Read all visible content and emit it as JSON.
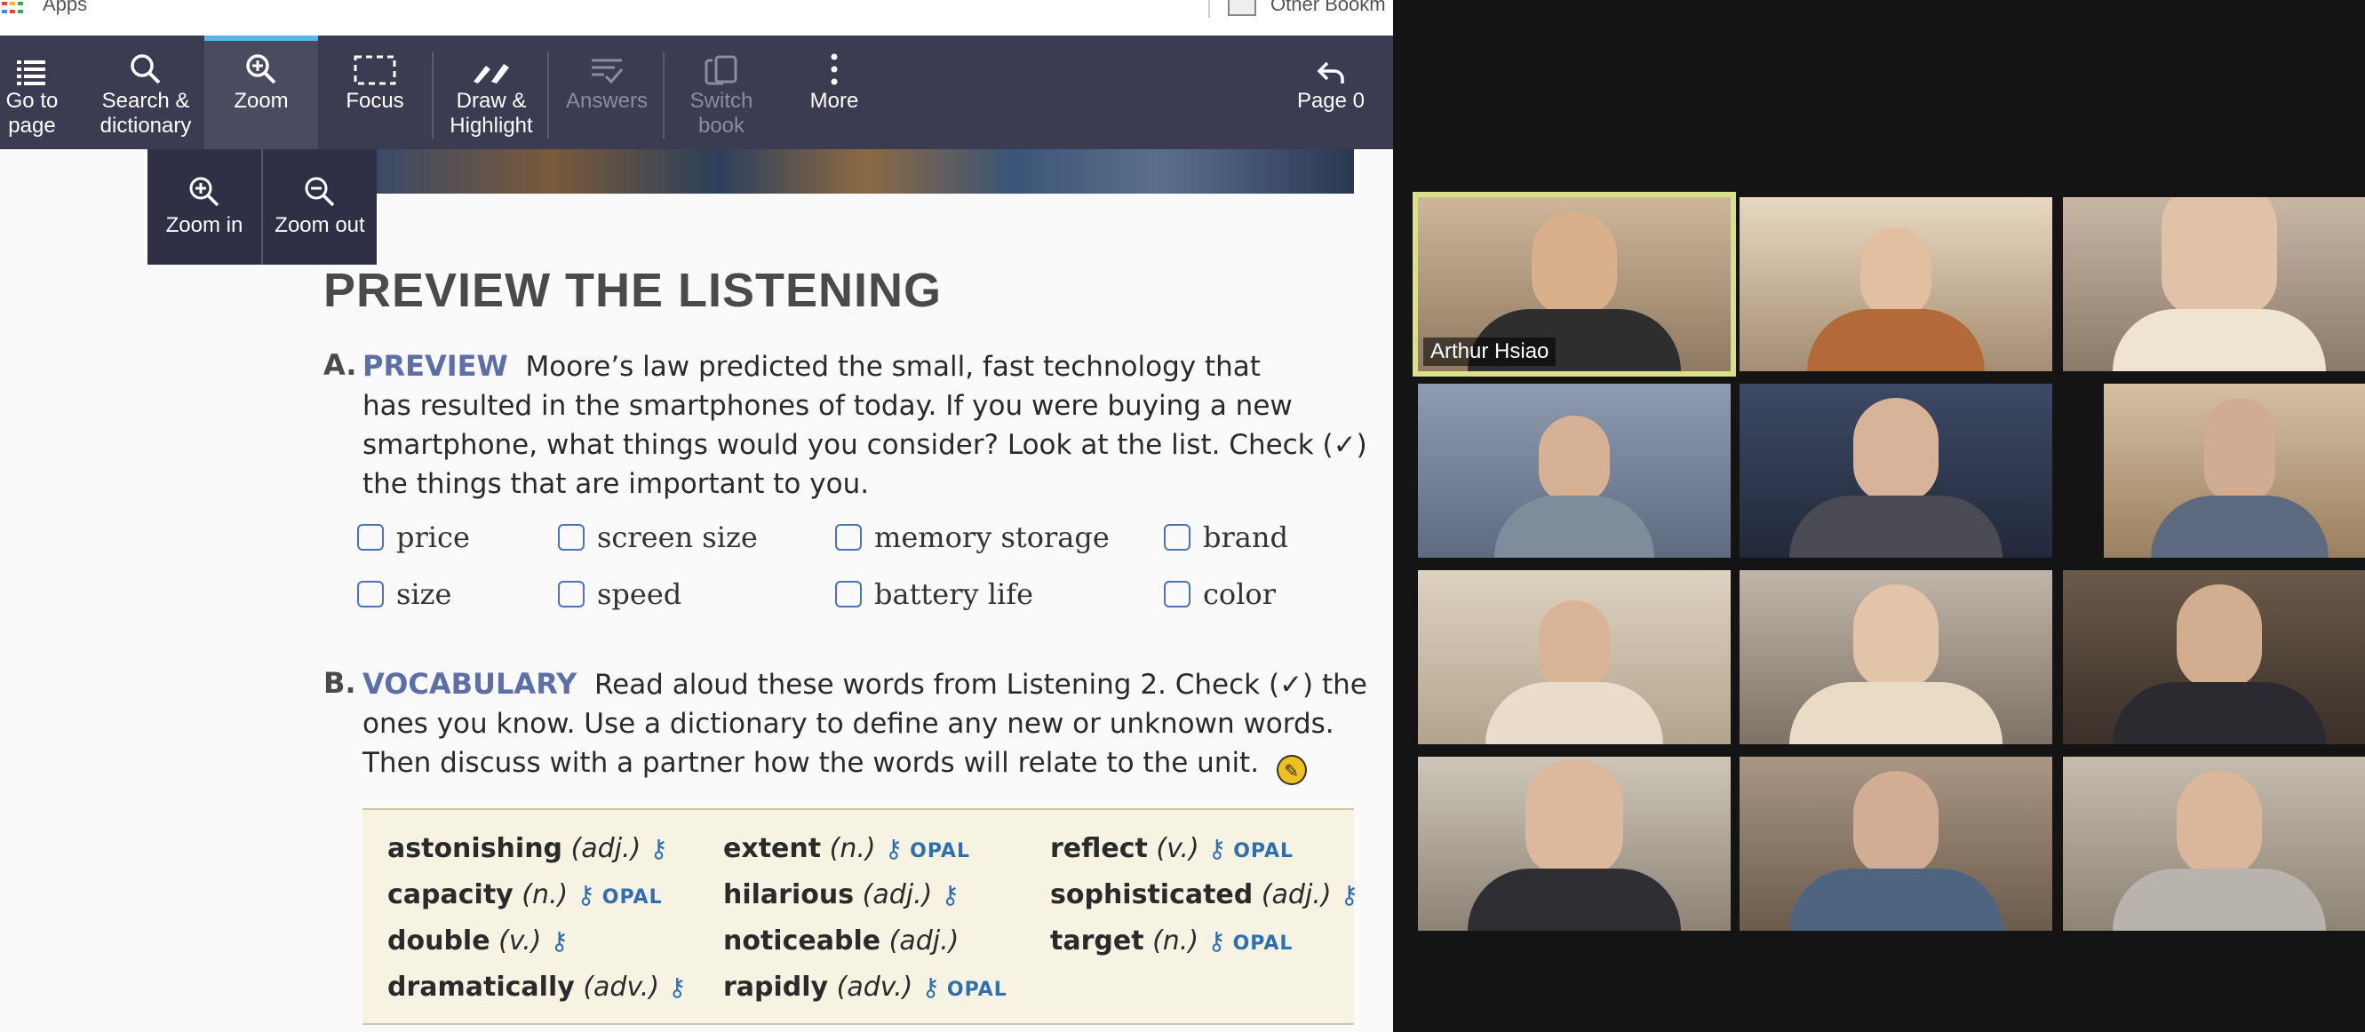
{
  "browser": {
    "apps_label": "Apps",
    "other_bookmarks_label": "Other Bookm"
  },
  "toolbar": {
    "items": [
      {
        "label_line1": "Go to",
        "label_line2": "page",
        "icon": "list-icon",
        "state": "normal"
      },
      {
        "label_line1": "Search &",
        "label_line2": "dictionary",
        "icon": "search-icon",
        "state": "normal"
      },
      {
        "label_line1": "Zoom",
        "label_line2": "",
        "icon": "zoom-icon",
        "state": "active"
      },
      {
        "label_line1": "Focus",
        "label_line2": "",
        "icon": "focus-icon",
        "state": "normal"
      },
      {
        "label_line1": "Draw &",
        "label_line2": "Highlight",
        "icon": "pen-icon",
        "state": "normal"
      },
      {
        "label_line1": "Answers",
        "label_line2": "",
        "icon": "answers-icon",
        "state": "disabled"
      },
      {
        "label_line1": "Switch",
        "label_line2": "book",
        "icon": "switch-book-icon",
        "state": "disabled"
      },
      {
        "label_line1": "More",
        "label_line2": "",
        "icon": "more-icon",
        "state": "normal"
      }
    ],
    "page_label": "Page 0",
    "active_color": "#58b7e8"
  },
  "zoom_menu": {
    "zoom_in": "Zoom in",
    "zoom_out": "Zoom out"
  },
  "page": {
    "heading": "PREVIEW THE LISTENING",
    "section_a": {
      "letter": "A.",
      "title": "PREVIEW",
      "lines": [
        "Moore’s law predicted the small, fast technology that",
        "has resulted in the smartphones of today. If you were buying a new",
        "smartphone, what things would you consider? Look at the list. Check (✓)",
        "the things that are important to you."
      ],
      "checklist": [
        "price",
        "screen size",
        "memory storage",
        "brand",
        "size",
        "speed",
        "battery life",
        "color"
      ]
    },
    "section_b": {
      "letter": "B.",
      "title": "VOCABULARY",
      "lines": [
        "Read aloud these words from Listening 2. Check (✓) the",
        "ones you know. Use a dictionary to define any new or unknown words.",
        "Then discuss with a partner how the words will relate to the unit."
      ]
    },
    "vocabulary": [
      {
        "word": "astonishing",
        "pos": "(adj.)",
        "key": true,
        "opal": ""
      },
      {
        "word": "capacity",
        "pos": "(n.)",
        "key": true,
        "opal": "OPAL"
      },
      {
        "word": "double",
        "pos": "(v.)",
        "key": true,
        "opal": ""
      },
      {
        "word": "dramatically",
        "pos": "(adv.)",
        "key": true,
        "opal": ""
      },
      {
        "word": "extent",
        "pos": "(n.)",
        "key": true,
        "opal": "OPAL"
      },
      {
        "word": "hilarious",
        "pos": "(adj.)",
        "key": true,
        "opal": ""
      },
      {
        "word": "noticeable",
        "pos": "(adj.)",
        "key": false,
        "opal": ""
      },
      {
        "word": "rapidly",
        "pos": "(adv.)",
        "key": true,
        "opal": "OPAL"
      },
      {
        "word": "reflect",
        "pos": "(v.)",
        "key": true,
        "opal": "OPAL"
      },
      {
        "word": "sophisticated",
        "pos": "(adj.)",
        "key": true,
        "opal": ""
      },
      {
        "word": "target",
        "pos": "(n.)",
        "key": true,
        "opal": "OPAL"
      }
    ]
  },
  "gallery": {
    "speaker_name": "Arthur Hsiao",
    "speaking_border_color": "#d8e08a",
    "participants": 12
  }
}
